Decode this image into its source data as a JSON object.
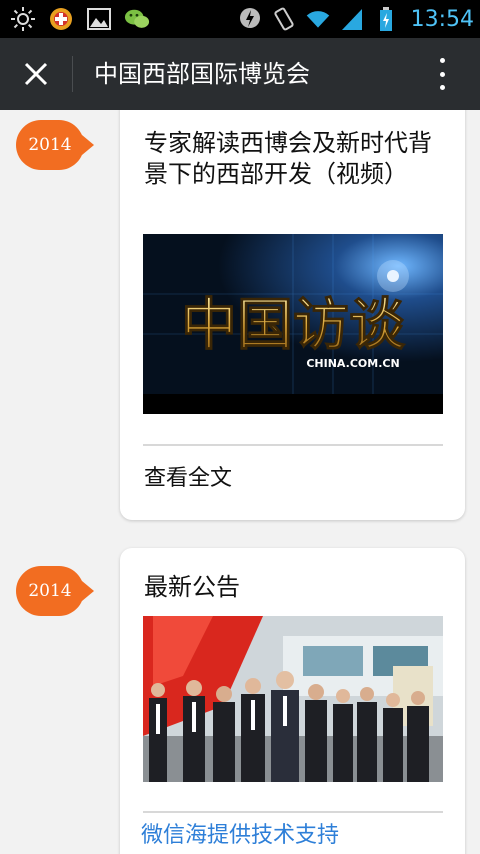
{
  "status_bar": {
    "time": "13:54",
    "icons_left": [
      "brightness-icon",
      "app-plus-icon",
      "gallery-icon",
      "wechat-icon"
    ],
    "icons_right": [
      "notification-icon",
      "vibrate-icon",
      "wifi-icon",
      "signal-icon",
      "battery-icon"
    ],
    "clock_color": "#4fc3f7"
  },
  "header": {
    "title": "中国西部国际博览会",
    "background": "#2a2d30"
  },
  "timeline": {
    "accent": "#f26d21",
    "items": [
      {
        "year": "2014",
        "title": "专家解读西博会及新时代背景下的西部开发（视频）",
        "image_big_text": "中国访谈",
        "image_small_text": "CHINA.COM.CN",
        "read_more": "查看全文"
      },
      {
        "year": "2014",
        "title": "最新公告"
      }
    ]
  },
  "footer": {
    "support_text": "微信海提供技术支持",
    "color": "#2e7fd8"
  }
}
